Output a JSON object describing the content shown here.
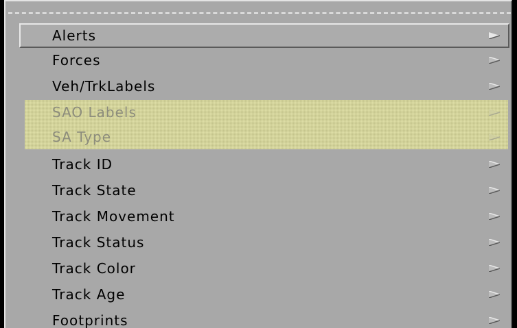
{
  "menu": {
    "items": [
      {
        "label": "Alerts",
        "state": "active",
        "icon": "submenu-arrow-icon"
      },
      {
        "label": "Forces",
        "state": "normal",
        "icon": "submenu-arrow-icon"
      },
      {
        "label": "Veh/TrkLabels",
        "state": "normal",
        "icon": "submenu-arrow-icon"
      },
      {
        "label": "SAO Labels",
        "state": "disabled",
        "icon": "submenu-arrow-icon"
      },
      {
        "label": "SA Type",
        "state": "disabled",
        "icon": "submenu-arrow-icon"
      },
      {
        "label": "Track ID",
        "state": "normal",
        "icon": "submenu-arrow-icon"
      },
      {
        "label": "Track State",
        "state": "normal",
        "icon": "submenu-arrow-icon"
      },
      {
        "label": "Track Movement",
        "state": "normal",
        "icon": "submenu-arrow-icon"
      },
      {
        "label": "Track Status",
        "state": "normal",
        "icon": "submenu-arrow-icon"
      },
      {
        "label": "Track Color",
        "state": "normal",
        "icon": "submenu-arrow-icon"
      },
      {
        "label": "Track Age",
        "state": "normal",
        "icon": "submenu-arrow-icon"
      },
      {
        "label": "Footprints",
        "state": "normal",
        "icon": "submenu-arrow-icon"
      }
    ]
  },
  "colors": {
    "menu_background": "#a8a8a8",
    "disabled_highlight": "#c4c48c",
    "disabled_text": "#8c8c7c",
    "text": "#000000"
  }
}
